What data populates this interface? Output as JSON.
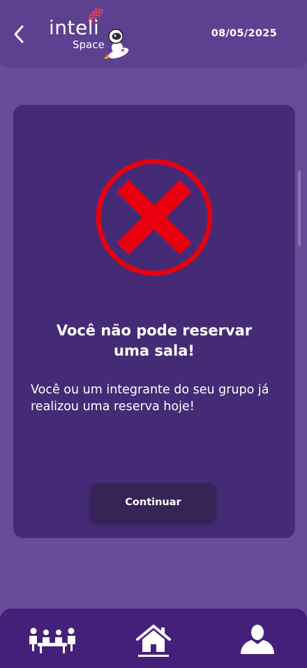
{
  "header": {
    "logo_text": "inteli",
    "logo_sub": "Space",
    "date": "08/05/2025"
  },
  "card": {
    "title_line1": "Você não pode reservar",
    "title_line2": "uma sala!",
    "message": "Você ou um integrante do seu grupo já realizou uma reserva hoje!",
    "button_label": "Continuar"
  },
  "colors": {
    "background": "#694c98",
    "header": "#5d4190",
    "card": "#452b75",
    "button": "#362456",
    "nav": "#44207a",
    "error": "#e8000f",
    "logo_accent": "#e8414b"
  },
  "icons": {
    "back": "chevron-left-icon",
    "error": "error-x-circle-icon",
    "rooms": "meeting-room-icon",
    "home": "home-icon",
    "profile": "user-icon"
  }
}
